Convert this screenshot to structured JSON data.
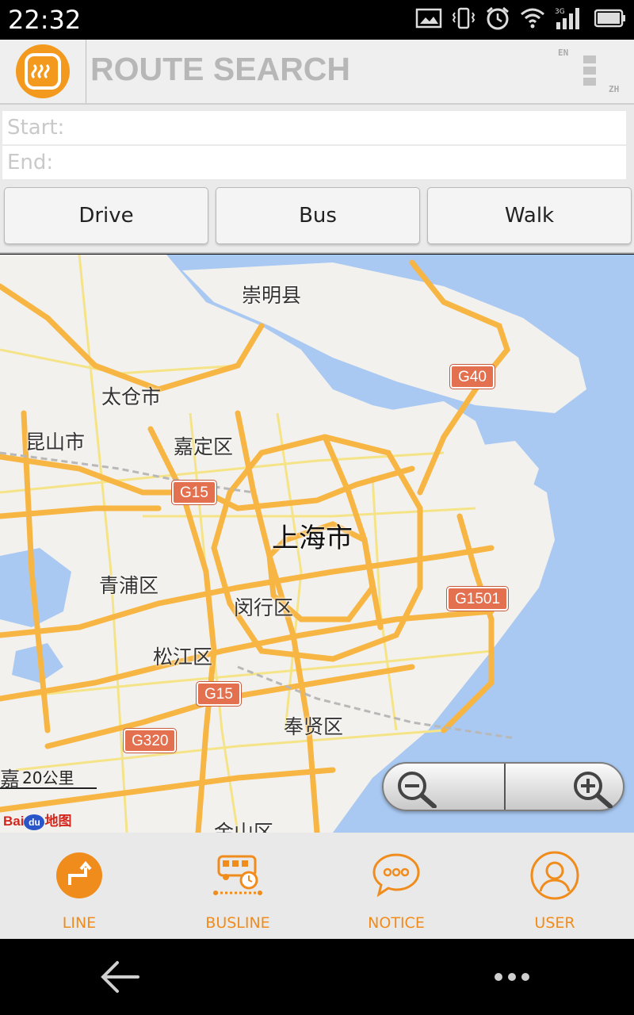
{
  "status_bar": {
    "time": "22:32",
    "network": "3G",
    "icons": [
      "image-notification-icon",
      "vibrate-icon",
      "alarm-icon",
      "wifi-icon",
      "signal-icon",
      "battery-icon"
    ]
  },
  "header": {
    "title": "ROUTE SEARCH",
    "lang_en": "EN",
    "lang_zh": "ZH"
  },
  "route_form": {
    "start_placeholder": "Start:",
    "end_placeholder": "End:",
    "start_value": "",
    "end_value": ""
  },
  "modes": {
    "drive": "Drive",
    "bus": "Bus",
    "walk": "Walk"
  },
  "map": {
    "places": {
      "chongming": "崇明县",
      "taicang": "太仓市",
      "kunshan": "昆山市",
      "jiading": "嘉定区",
      "shanghai": "上海市",
      "qingpu": "青浦区",
      "minhang": "闵行区",
      "songjiang": "松江区",
      "fengxian": "奉贤区",
      "jinshan": "金山区",
      "jia_partial": "嘉"
    },
    "highways": {
      "g40": "G40",
      "g15_north": "G15",
      "g1501": "G1501",
      "g15_south": "G15",
      "g320": "G320"
    },
    "scale_label": "20公里",
    "provider": "Bai",
    "provider_paw": "du",
    "provider_suffix": "地图",
    "colors": {
      "land": "#f3f1ed",
      "water": "#a9c9f2",
      "highway": "#f7b543",
      "road": "#f5e487",
      "shield": "#e3704f"
    }
  },
  "bottom_nav": {
    "line": "LINE",
    "busline": "BUSLINE",
    "notice": "NOTICE",
    "user": "USER",
    "accent": "#f08c1c"
  }
}
